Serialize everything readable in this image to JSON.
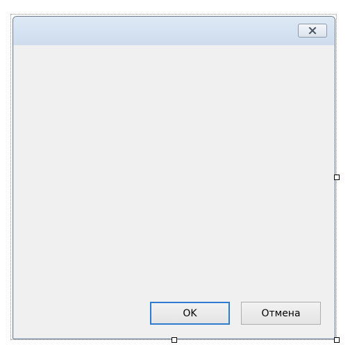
{
  "dialog": {
    "title": "",
    "close_icon": "close-icon",
    "ok_label": "OK",
    "cancel_label": "Отмена"
  },
  "colors": {
    "title_bar": "#d3e1f1",
    "client_background": "#f0f0f0",
    "default_button_border": "#2d7bd1",
    "button_border": "#adadad"
  }
}
